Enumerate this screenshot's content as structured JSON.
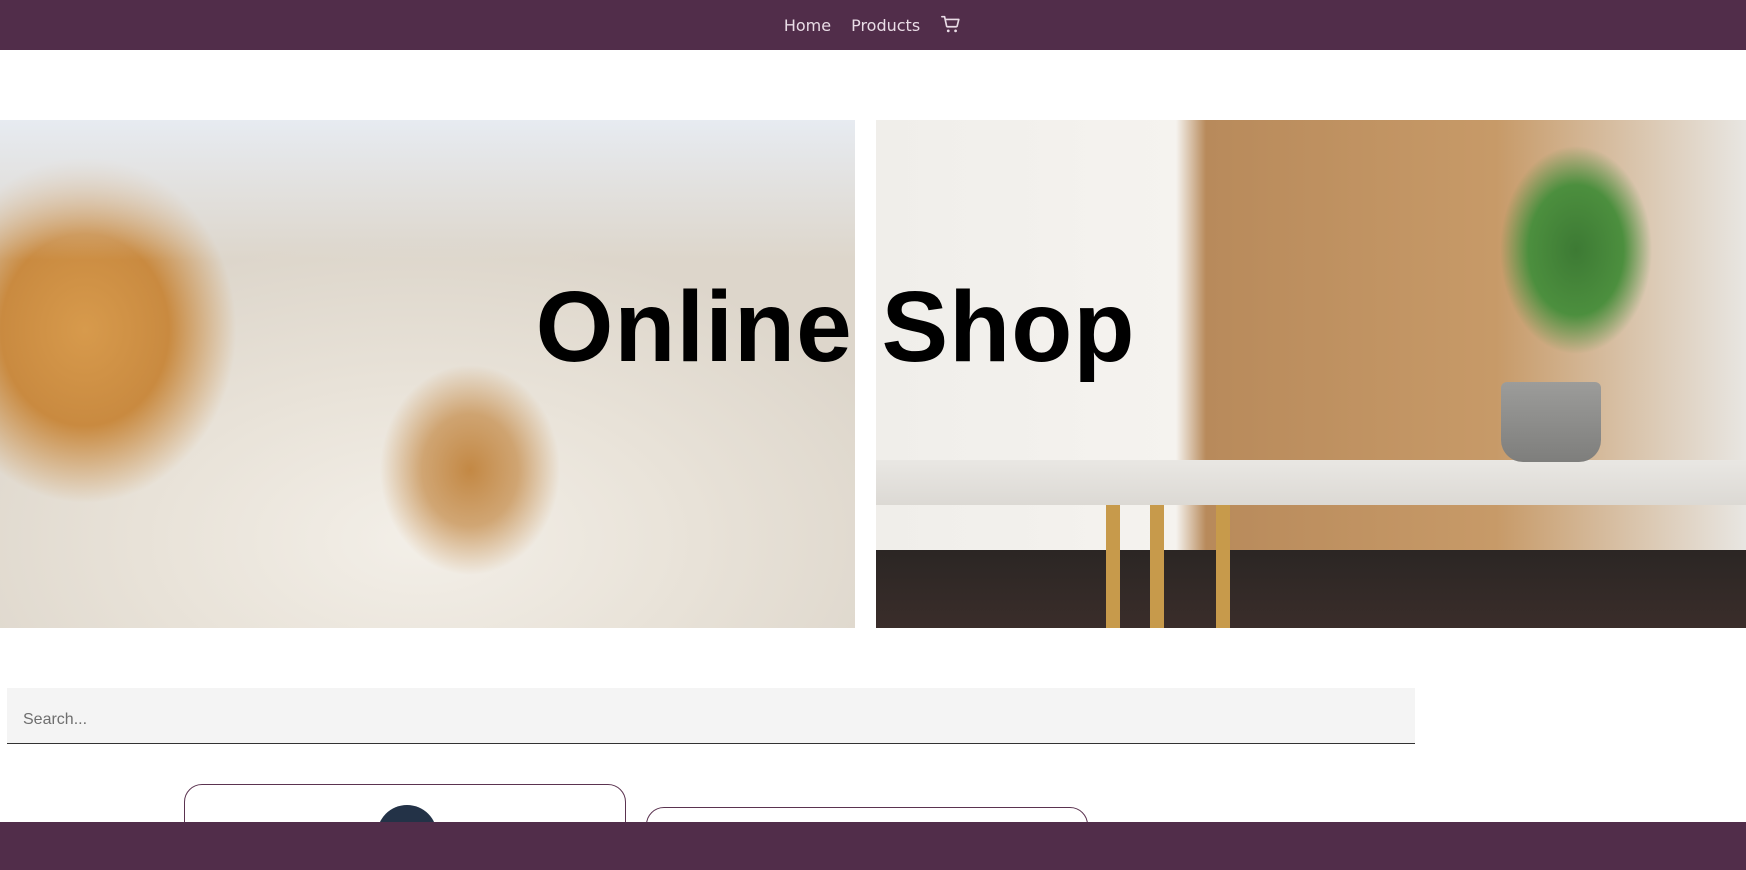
{
  "nav": {
    "links": [
      "Home",
      "Products"
    ],
    "cart_icon": "shopping-cart-icon",
    "background": "#512d4a",
    "link_color": "#e9dce6"
  },
  "hero": {
    "title": "Online Shop"
  },
  "search": {
    "placeholder": "Search..."
  },
  "footer": {
    "background": "#512d4a"
  }
}
